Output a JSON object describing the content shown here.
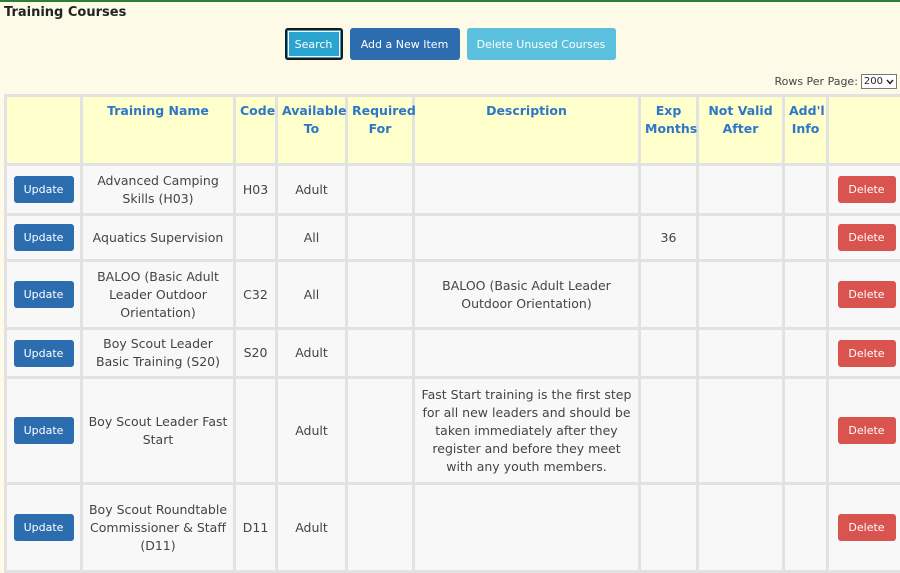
{
  "page": {
    "title": "Training Courses"
  },
  "toolbar": {
    "search_label": "Search",
    "add_label": "Add a New Item",
    "delete_unused_label": "Delete Unused Courses"
  },
  "pagination": {
    "rows_label": "Rows Per Page:",
    "rows_value": "200"
  },
  "table": {
    "headers": [
      "",
      "Training Name",
      "Code",
      "Available To",
      "Required For",
      "Description",
      "Exp Months",
      "Not Valid After",
      "Add'l Info",
      ""
    ],
    "update_label": "Update",
    "delete_label": "Delete",
    "rows": [
      {
        "name": "Advanced Camping Skills (H03)",
        "code": "H03",
        "available": "Adult",
        "required": "",
        "description": "",
        "exp": "",
        "not_valid": "",
        "info": ""
      },
      {
        "name": "Aquatics Supervision",
        "code": "",
        "available": "All",
        "required": "",
        "description": "",
        "exp": "36",
        "not_valid": "",
        "info": ""
      },
      {
        "name": "BALOO (Basic Adult Leader Outdoor Orientation)",
        "code": "C32",
        "available": "All",
        "required": "",
        "description": "BALOO (Basic Adult Leader Outdoor Orientation)",
        "exp": "",
        "not_valid": "",
        "info": ""
      },
      {
        "name": "Boy Scout Leader Basic Training (S20)",
        "code": "S20",
        "available": "Adult",
        "required": "",
        "description": "",
        "exp": "",
        "not_valid": "",
        "info": ""
      },
      {
        "name": "Boy Scout Leader Fast Start",
        "code": "",
        "available": "Adult",
        "required": "",
        "description": "Fast Start training is the first step for all new leaders and should be taken immediately after they register and before they meet with any youth members.",
        "exp": "",
        "not_valid": "",
        "info": ""
      },
      {
        "name": "Boy Scout Roundtable Commissioner & Staff (D11)",
        "code": "D11",
        "available": "Adult",
        "required": "",
        "description": "",
        "exp": "",
        "not_valid": "",
        "info": ""
      }
    ]
  },
  "colors": {
    "header_bg": "#ffffcc",
    "header_text": "#2e77c7",
    "update": "#2c6db0",
    "delete": "#d9534f",
    "search": "#2aa3cf",
    "delete_unused": "#5bc0de"
  }
}
